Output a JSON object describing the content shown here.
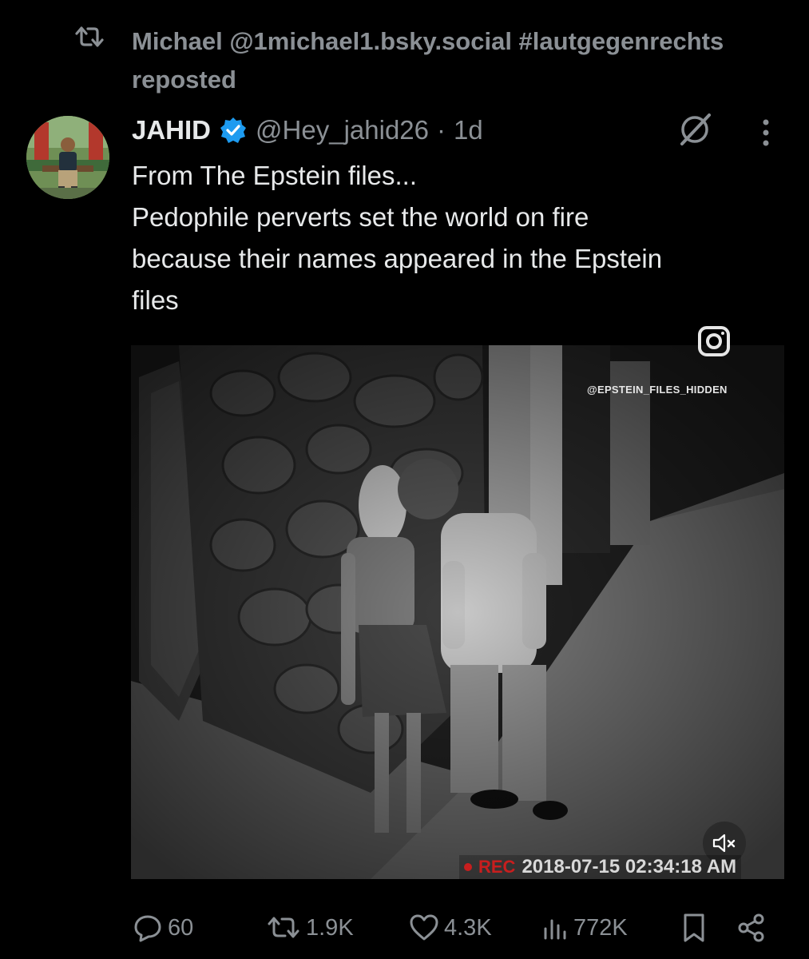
{
  "repost": {
    "line1": "Michael @1michael1.bsky.social #lautgegenrechts",
    "line2": "reposted",
    "icon": "repost-icon"
  },
  "author": {
    "name": "JAHID",
    "handle": "@Hey_jahid26",
    "separator": "·",
    "age": "1d",
    "verified": true
  },
  "post": {
    "lines": [
      "From The Epstein files...",
      "Pedophile perverts set the world on fire",
      "because their names appeared in the Epstein",
      "files"
    ]
  },
  "media": {
    "watermark": "@EPSTEIN_FILES_HIDDEN",
    "rec_label": "REC",
    "timestamp": "2018-07-15 02:34:18 AM",
    "muted": true
  },
  "actions": {
    "replies": "60",
    "reposts": "1.9K",
    "likes": "4.3K",
    "views": "772K"
  },
  "colors": {
    "background": "#000000",
    "text_primary": "#e7e9ea",
    "text_secondary": "#8b9095",
    "verified_blue": "#1d9bf0",
    "rec_red": "#c81e1e"
  }
}
